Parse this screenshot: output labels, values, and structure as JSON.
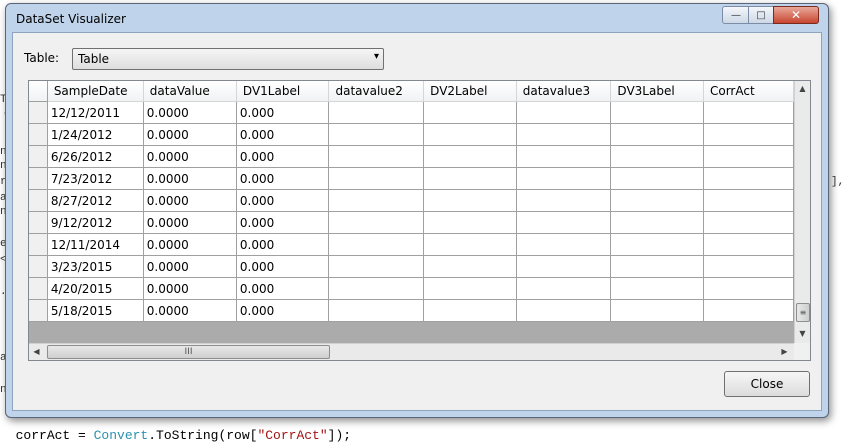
{
  "window": {
    "title": "DataSet Visualizer",
    "minimize_glyph": "—",
    "maximize_glyph": "□",
    "close_glyph": "✕"
  },
  "table_selector": {
    "label": "Table:",
    "selected": "Table",
    "arrow_glyph": "▾"
  },
  "grid": {
    "columns": [
      "SampleDate",
      "dataValue",
      "DV1Label",
      "datavalue2",
      "DV2Label",
      "datavalue3",
      "DV3Label",
      "CorrAct"
    ],
    "rows": [
      [
        "12/12/2011",
        "0.0000",
        "0.000",
        "",
        "",
        "",
        "",
        ""
      ],
      [
        "1/24/2012",
        "0.0000",
        "0.000",
        "",
        "",
        "",
        "",
        ""
      ],
      [
        "6/26/2012",
        "0.0000",
        "0.000",
        "",
        "",
        "",
        "",
        ""
      ],
      [
        "7/23/2012",
        "0.0000",
        "0.000",
        "",
        "",
        "",
        "",
        ""
      ],
      [
        "8/27/2012",
        "0.0000",
        "0.000",
        "",
        "",
        "",
        "",
        ""
      ],
      [
        "9/12/2012",
        "0.0000",
        "0.000",
        "",
        "",
        "",
        "",
        ""
      ],
      [
        "12/11/2014",
        "0.0000",
        "0.000",
        "",
        "",
        "",
        "",
        ""
      ],
      [
        "3/23/2015",
        "0.0000",
        "0.000",
        "",
        "",
        "",
        "",
        ""
      ],
      [
        "4/20/2015",
        "0.0000",
        "0.000",
        "",
        "",
        "",
        "",
        ""
      ],
      [
        "5/18/2015",
        "0.0000",
        "0.000",
        "",
        "",
        "",
        "",
        ""
      ]
    ],
    "scroll_glyphs": {
      "up": "▲",
      "down": "▼",
      "left": "◀",
      "right": "▶",
      "grip_v": "≡",
      "grip_h": "III"
    }
  },
  "buttons": {
    "close_label": "Close"
  },
  "background_code": {
    "bottom_line_prefix": "corrAct = ",
    "bottom_line_class": "Convert",
    "bottom_line_method": ".ToString(row[",
    "bottom_line_string": "\"CorrAct\"",
    "bottom_line_suffix": "]);",
    "fragments": [
      "T",
      "c",
      "n",
      "n",
      "r",
      "a",
      "n",
      "e",
      "<",
      ".",
      "a",
      "n",
      "],"
    ]
  }
}
